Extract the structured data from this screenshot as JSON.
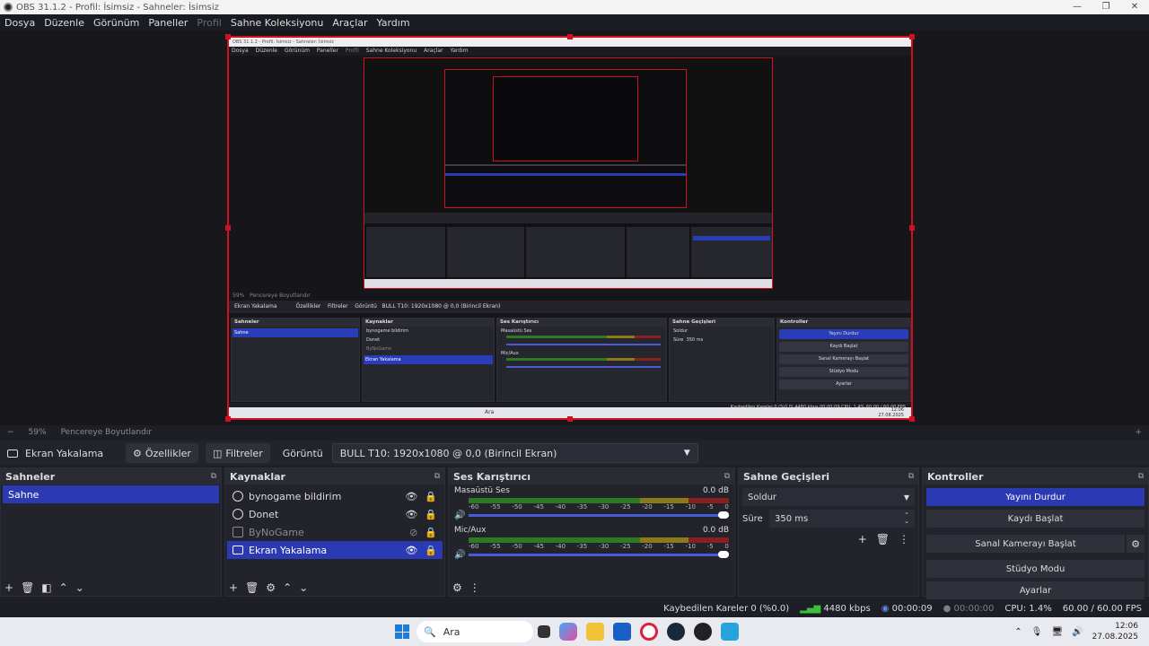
{
  "window": {
    "title": "OBS 31.1.2 - Profil: İsimsiz - Sahneler: İsimsiz",
    "controls": [
      "—",
      "❐",
      "✕"
    ]
  },
  "menu": [
    "Dosya",
    "Düzenle",
    "Görünüm",
    "Paneller",
    "Profil",
    "Sahne Koleksiyonu",
    "Araçlar",
    "Yardım"
  ],
  "zoom": {
    "minus": "−",
    "value": "59%",
    "label": "Pencereye Boyutlandır"
  },
  "sourcebar": {
    "name": "Ekran Yakalama",
    "properties": "Özellikler",
    "filters": "Filtreler",
    "display_label": "Görüntü",
    "display_value": "BULL T10: 1920x1080 @ 0,0 (Birincil Ekran)"
  },
  "scenes": {
    "header": "Sahneler",
    "items": [
      "Sahne"
    ]
  },
  "sources": {
    "header": "Kaynaklar",
    "items": [
      {
        "name": "bynogame bildirim",
        "visible": "👁",
        "lock": "🔒"
      },
      {
        "name": "Donet",
        "visible": "👁",
        "lock": "🔒"
      },
      {
        "name": "ByNoGame",
        "visible": "⊘",
        "lock": "🔒"
      },
      {
        "name": "Ekran Yakalama",
        "visible": "👁",
        "lock": "🔒"
      }
    ]
  },
  "mixer": {
    "header": "Ses Karıştırıcı",
    "channels": [
      {
        "name": "Masaüstü Ses",
        "db": "0.0 dB"
      },
      {
        "name": "Mic/Aux",
        "db": "0.0 dB"
      }
    ],
    "ticks": [
      "-60",
      "-55",
      "-50",
      "-45",
      "-40",
      "-35",
      "-30",
      "-25",
      "-20",
      "-15",
      "-10",
      "-5",
      "0"
    ]
  },
  "transitions": {
    "header": "Sahne Geçişleri",
    "selected": "Soldur",
    "duration_label": "Süre",
    "duration_value": "350 ms"
  },
  "controls": {
    "header": "Kontroller",
    "buttons": [
      "Yayını Durdur",
      "Kaydı Başlat",
      "Sanal Kamerayı Başlat",
      "Stüdyo Modu",
      "Ayarlar"
    ]
  },
  "status": {
    "dropped": "Kaybedilen Kareler 0 (%0.0)",
    "bitrate": "4480 kbps",
    "stream_time": "00:00:09",
    "rec_time": "00:00:00",
    "cpu": "CPU: 1.4%",
    "fps": "60.00 / 60.00 FPS"
  },
  "taskbar": {
    "search": "Ara",
    "time": "12:06",
    "date": "27.08.2025"
  },
  "mini": {
    "title": "OBS 31.1.2 - Profil: İsimsiz - Sahneler: İsimsiz",
    "source": "Ekran Yakalama",
    "properties": "Özellikler",
    "filters": "Filtreler",
    "display": "Görüntü",
    "display_value": "BULL T10: 1920x1080 @ 0,0 (Birincil Ekran)",
    "zoom": "59%",
    "fit": "Pencereye Boyutlandır",
    "status": "Kaybedilen Kareler 0 (%0.0)   4480 kbps   00:00:09   CPU: 1.4%   60.00 / 60.00 FPS",
    "taskbar_search": "Ara",
    "taskbar_time": "12:06",
    "taskbar_date": "27.08.2025"
  },
  "colors": {
    "accent": "#2b3ab3",
    "selection_border": "#d01020"
  }
}
